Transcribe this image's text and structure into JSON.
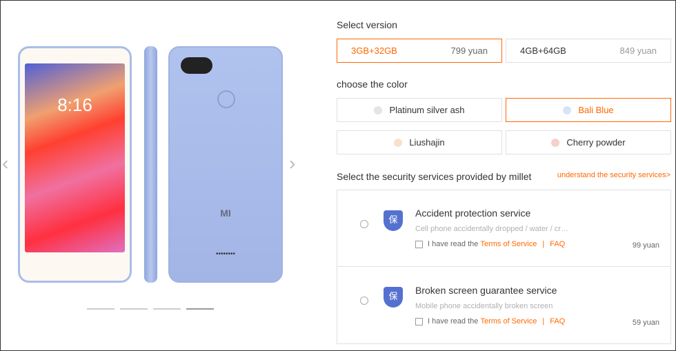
{
  "gallery": {
    "clock": "8:16",
    "logo": "MI",
    "speaker": "••••••••",
    "indicators": 4,
    "active_indicator": 4
  },
  "version": {
    "heading": "Select version",
    "options": [
      {
        "name": "3GB+32GB",
        "price": "799 yuan",
        "selected": true
      },
      {
        "name": "4GB+64GB",
        "price": "849 yuan",
        "selected": false
      }
    ]
  },
  "color": {
    "heading": "choose the color",
    "options": [
      {
        "name": "Platinum silver ash",
        "swatch": "#e4e4e4",
        "selected": false
      },
      {
        "name": "Bali Blue",
        "swatch": "#d5e4f6",
        "selected": true
      },
      {
        "name": "Liushajin",
        "swatch": "#f6e2c8",
        "selected": false
      },
      {
        "name": "Cherry powder",
        "swatch": "#f6d0cc",
        "selected": false
      }
    ]
  },
  "security": {
    "heading": "Select the security services provided by millet",
    "link": "understand the security services>",
    "services": [
      {
        "icon": "保",
        "title": "Accident protection service",
        "desc": "Cell phone accidentally dropped / water / cr…",
        "read": "I have read the",
        "terms": "Terms of Service",
        "sep": "|",
        "faq": "FAQ",
        "price": "99 yuan"
      },
      {
        "icon": "保",
        "title": "Broken screen guarantee service",
        "desc": "Mobile phone accidentally broken screen",
        "read": "I have read the",
        "terms": "Terms of Service",
        "sep": "|",
        "faq": "FAQ",
        "price": "59 yuan"
      }
    ]
  },
  "colors": {
    "accent": "#ff6700"
  }
}
